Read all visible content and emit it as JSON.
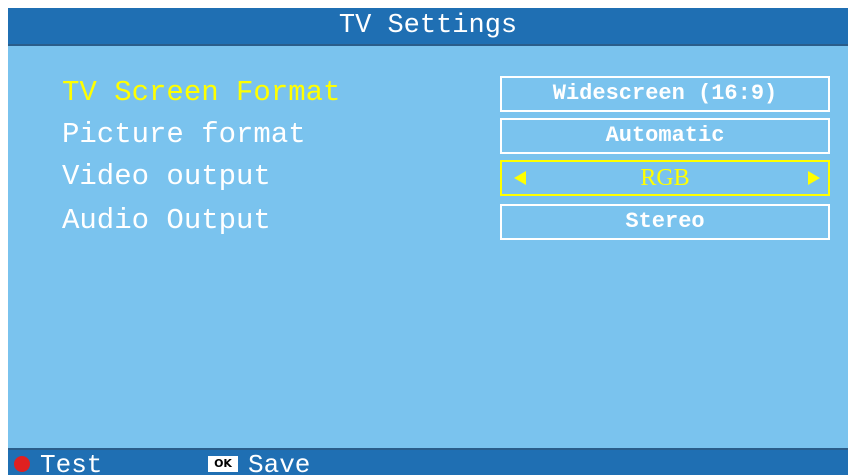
{
  "title": "TV Settings",
  "settings": [
    {
      "label": "TV Screen Format",
      "value": "Widescreen (16:9)",
      "active": true
    },
    {
      "label": "Picture format",
      "value": "Automatic",
      "active": false
    },
    {
      "label": "Video output",
      "value": "RGB",
      "selected": true
    },
    {
      "label": "Audio Output",
      "value": "Stereo",
      "active": false
    }
  ],
  "footer": {
    "test_label": "Test",
    "ok_key": "OK",
    "save_label": "Save"
  },
  "colors": {
    "background": "#7ac3ee",
    "bar": "#1f6fb3",
    "highlight": "#ffff00",
    "text": "#ffffff",
    "red_button": "#e02020"
  },
  "icons": {
    "left": "left-arrow-icon",
    "right": "right-arrow-icon",
    "red": "red-button-icon",
    "ok": "ok-key-icon"
  }
}
